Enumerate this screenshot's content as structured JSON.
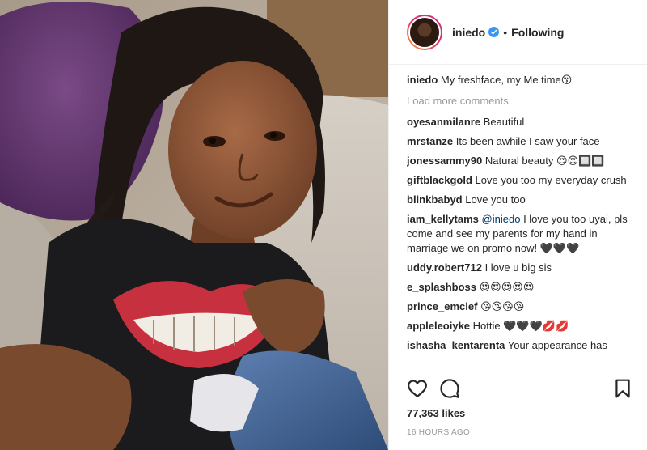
{
  "colors": {
    "link": "#003569",
    "muted": "#999999",
    "verified": "#3897f0",
    "text": "#262626"
  },
  "header": {
    "username": "iniedo",
    "separator": "•",
    "follow_status": "Following"
  },
  "caption": {
    "username": "iniedo",
    "text": "My freshface, my Me time😚"
  },
  "load_more": "Load more comments",
  "comments": [
    {
      "username": "oyesanmilanre",
      "text": "Beautiful"
    },
    {
      "username": "mrstanze",
      "text": "Its been awhile I saw your face"
    },
    {
      "username": "jonessammy90",
      "text": "Natural beauty 😍😍🔲🔲"
    },
    {
      "username": "giftblackgold",
      "text": "Love you too my everyday crush"
    },
    {
      "username": "blinkbabyd",
      "text": "Love you too"
    },
    {
      "username": "iam_kellytams",
      "mention": "@iniedo",
      "text": "I love you too uyai, pls come and see my parents for my hand in marriage we on promo now! 🖤🖤🖤"
    },
    {
      "username": "uddy.robert712",
      "text": "I love u big sis"
    },
    {
      "username": "e_splashboss",
      "text": "😍😍😍😍😍"
    },
    {
      "username": "prince_emclef",
      "text": "😘😘😘😘"
    },
    {
      "username": "appleleoiyke",
      "text": "Hottie 🖤🖤🖤💋💋"
    },
    {
      "username": "ishasha_kentarenta",
      "text": "Your appearance has"
    }
  ],
  "actions": {
    "like_icon": "heart-icon",
    "comment_icon": "comment-icon",
    "save_icon": "bookmark-icon"
  },
  "likes": "77,363 likes",
  "timestamp": "16 HOURS AGO"
}
